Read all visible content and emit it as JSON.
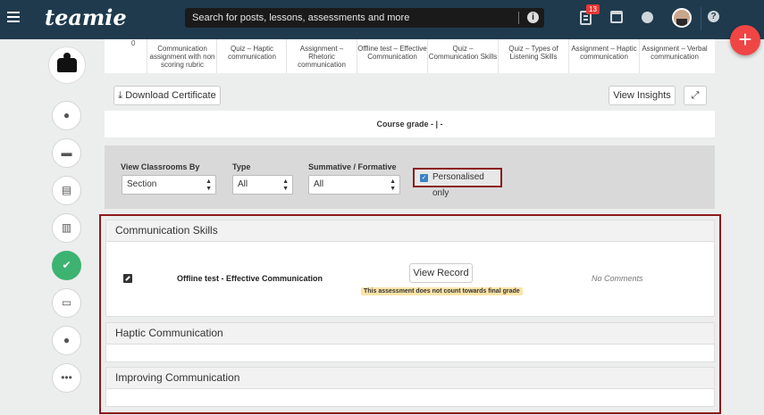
{
  "header": {
    "logo_text": "teamie",
    "search_placeholder": "Search for posts, lessons, assessments and more",
    "notification_count": "13",
    "search_info_icon": "info-circle-icon",
    "help_icon": "question-circle-icon"
  },
  "sidebar": {
    "items": [
      {
        "icon": "comment-icon"
      },
      {
        "icon": "folder-icon"
      },
      {
        "icon": "newspaper-icon"
      },
      {
        "icon": "bar-chart-icon"
      },
      {
        "icon": "check-square-icon",
        "active": true
      },
      {
        "icon": "monitor-icon"
      },
      {
        "icon": "user-icon"
      },
      {
        "icon": "more-icon"
      }
    ]
  },
  "gradebook": {
    "axis_zero": "0",
    "columns": [
      "Communication assignment with non scoring rubric",
      "Quiz – Haptic communication",
      "Assignment – Rhetoric communication",
      "Offline test – Effective Communication",
      "Quiz – Communication Skills",
      "Quiz – Types of Listening Skills",
      "Assignment – Haptic communication",
      "Assignment – Verbal communication"
    ],
    "download_label": "Download Certificate",
    "insights_label": "View Insights",
    "course_grade": "Course grade - | -"
  },
  "filters": {
    "classrooms_label": "View Classrooms By",
    "classrooms_value": "Section",
    "type_label": "Type",
    "type_value": "All",
    "summative_label": "Summative / Formative",
    "summative_value": "All",
    "personalised_label": "Personalised only",
    "personalised_checked": true
  },
  "sections": [
    {
      "title": "Communication Skills",
      "items": [
        {
          "name": "Offline test - Effective Communication",
          "button": "View Record",
          "note": "This assessment does not count towards final grade",
          "comments": "No Comments"
        }
      ]
    },
    {
      "title": "Haptic Communication",
      "items": []
    },
    {
      "title": "Improving Communication",
      "items": []
    }
  ],
  "colors": {
    "topbar": "#1f3a4d",
    "accent_green": "#3cb371",
    "fab_red": "#ef4545",
    "highlight_border": "#8b1a1a"
  }
}
